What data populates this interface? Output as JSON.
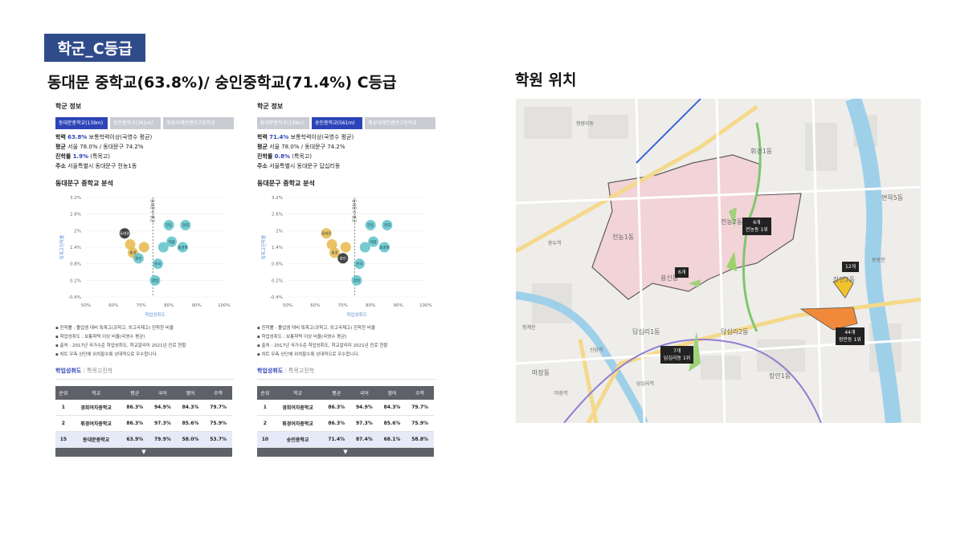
{
  "section_tag": "학군_C등급",
  "left_heading": "동대문 중학교(63.8%)/ 숭인중학교(71.4%) C등급",
  "right_heading": "학원 위치",
  "panels": [
    {
      "title": "학군 정보",
      "tabs": [
        "동대문중학교(139m)",
        "숭인중학교(361m)",
        "해성국제컨벤션고등학교"
      ],
      "active_tab": 0,
      "achievement_label": "학력",
      "achievement_value": "63.8%",
      "achievement_desc": "보통학력이상(국영수 평균)",
      "avg_label": "평균",
      "avg_value": "서울 78.0% / 동대문구 74.2%",
      "advance_label": "진학률",
      "advance_value": "1.9%",
      "advance_desc": "(특목고)",
      "addr_label": "주소",
      "addr_value": "서울특별시 동대문구 전농1동",
      "analysis_title": "동대문구 중학교 분석",
      "chart_data": {
        "type": "scatter",
        "xlabel": "학업성취도",
        "ylabel": "특목고진학률",
        "x_ticks": [
          "50%",
          "60%",
          "70%",
          "80%",
          "90%",
          "100%"
        ],
        "y_ticks": [
          "3.2%",
          "2.6%",
          "2%",
          "1.4%",
          "0.8%",
          "0.2%",
          "-0.4%"
        ],
        "xlim": [
          50,
          100
        ],
        "ylim": [
          -0.4,
          3.2
        ],
        "median_label": "동대문구 평균",
        "points": [
          {
            "label": "동대문",
            "x": 64,
            "y": 1.9,
            "color": "#222222"
          },
          {
            "label": "",
            "x": 66,
            "y": 1.5,
            "color": "#e8b84a"
          },
          {
            "label": "휘경",
            "x": 67,
            "y": 1.2,
            "color": "#e8b84a"
          },
          {
            "label": "",
            "x": 71,
            "y": 1.4,
            "color": "#e8b84a"
          },
          {
            "label": "숭인",
            "x": 69,
            "y": 1.0,
            "color": "#5cc2c9"
          },
          {
            "label": "전동",
            "x": 80,
            "y": 2.2,
            "color": "#5cc2c9"
          },
          {
            "label": "경희",
            "x": 86,
            "y": 2.2,
            "color": "#5cc2c9"
          },
          {
            "label": "대광",
            "x": 81,
            "y": 1.6,
            "color": "#5cc2c9"
          },
          {
            "label": "휘경여",
            "x": 85,
            "y": 1.4,
            "color": "#5cc2c9"
          },
          {
            "label": "",
            "x": 78,
            "y": 1.4,
            "color": "#5cc2c9"
          },
          {
            "label": "전곡",
            "x": 76,
            "y": 0.8,
            "color": "#5cc2c9"
          },
          {
            "label": "성일",
            "x": 75,
            "y": 0.2,
            "color": "#5cc2c9"
          }
        ]
      },
      "notes": [
        "▪ 진학률 : 졸업생 대비 특목고(과학고, 외고국제고) 진학한 비율",
        "▪ 학업성취도 : 보통학력 이상 비율(국영수 평균)",
        "▪ 출처 : 2017년 국가수준 학업성취도, 학교알리미 2021년 진로 현황",
        "▪ 차트 우측 상단에 위치할수록 상대적으로 우수합니다."
      ],
      "subtab_on": "학업성취도",
      "subtab_off": "특목고진학",
      "table_headers": [
        "순위",
        "학교",
        "평균",
        "국어",
        "영어",
        "수학"
      ],
      "table_rows": [
        [
          "1",
          "경희여자중학교",
          "86.3%",
          "94.9%",
          "84.3%",
          "79.7%"
        ],
        [
          "2",
          "휘경여자중학교",
          "86.3%",
          "97.3%",
          "85.6%",
          "75.9%"
        ],
        [
          "15",
          "동대문중학교",
          "63.9%",
          "79.9%",
          "58.0%",
          "53.7%"
        ]
      ],
      "more_glyph": "▼"
    },
    {
      "title": "학군 정보",
      "tabs": [
        "동대문중학교(139m)",
        "숭인중학교(561m)",
        "해성국제컨벤션고등학교"
      ],
      "active_tab": 1,
      "achievement_label": "학력",
      "achievement_value": "71.4%",
      "achievement_desc": "보통학력이상(국영수 평균)",
      "avg_label": "평균",
      "avg_value": "서울 78.0% / 동대문구 74.2%",
      "advance_label": "진학률",
      "advance_value": "0.8%",
      "advance_desc": "(특목고)",
      "addr_label": "주소",
      "addr_value": "서울특별시 동대문구 답십리동",
      "analysis_title": "동대문구 중학교 분석",
      "chart_data": {
        "type": "scatter",
        "xlabel": "학업성취도",
        "ylabel": "특목고진학률",
        "x_ticks": [
          "50%",
          "60%",
          "70%",
          "80%",
          "90%",
          "100%"
        ],
        "y_ticks": [
          "3.2%",
          "2.6%",
          "2%",
          "1.4%",
          "0.8%",
          "0.2%",
          "-0.4%"
        ],
        "xlim": [
          50,
          100
        ],
        "ylim": [
          -0.4,
          3.2
        ],
        "median_label": "동대문구 평균",
        "points": [
          {
            "label": "동대문",
            "x": 64,
            "y": 1.9,
            "color": "#e8b84a"
          },
          {
            "label": "",
            "x": 66,
            "y": 1.5,
            "color": "#e8b84a"
          },
          {
            "label": "휘경",
            "x": 67,
            "y": 1.2,
            "color": "#e8b84a"
          },
          {
            "label": "",
            "x": 71,
            "y": 1.4,
            "color": "#e8b84a"
          },
          {
            "label": "숭인",
            "x": 70,
            "y": 1.0,
            "color": "#222222"
          },
          {
            "label": "전동",
            "x": 80,
            "y": 2.2,
            "color": "#5cc2c9"
          },
          {
            "label": "경희",
            "x": 86,
            "y": 2.2,
            "color": "#5cc2c9"
          },
          {
            "label": "대광",
            "x": 81,
            "y": 1.6,
            "color": "#5cc2c9"
          },
          {
            "label": "휘경여",
            "x": 85,
            "y": 1.4,
            "color": "#5cc2c9"
          },
          {
            "label": "",
            "x": 78,
            "y": 1.4,
            "color": "#5cc2c9"
          },
          {
            "label": "전곡",
            "x": 76,
            "y": 0.8,
            "color": "#5cc2c9"
          },
          {
            "label": "성일",
            "x": 75,
            "y": 0.2,
            "color": "#5cc2c9"
          }
        ]
      },
      "notes": [
        "▪ 진학률 : 졸업생 대비 특목고(과학고, 외고국제고) 진학한 비율",
        "▪ 학업성취도 : 보통학력 이상 비율(국영수 평균)",
        "▪ 출처 : 2017년 국가수준 학업성취도, 학교알리미 2021년 진로 현황",
        "▪ 차트 우측 상단에 위치할수록 상대적으로 우수합니다."
      ],
      "subtab_on": "학업성취도",
      "subtab_off": "특목고진학",
      "table_headers": [
        "순위",
        "학교",
        "평균",
        "국어",
        "영어",
        "수학"
      ],
      "table_rows": [
        [
          "1",
          "경희여자중학교",
          "86.3%",
          "94.9%",
          "84.3%",
          "79.7%"
        ],
        [
          "2",
          "휘경여자중학교",
          "86.3%",
          "97.3%",
          "85.6%",
          "75.9%"
        ],
        [
          "10",
          "숭인중학교",
          "71.4%",
          "87.4%",
          "68.1%",
          "58.8%"
        ]
      ],
      "more_glyph": "▼"
    }
  ],
  "map": {
    "labels": [
      "청량리동",
      "전농1동",
      "전농2동",
      "휘경1동",
      "답십리1동",
      "답십리2동",
      "장안2동",
      "장안1동",
      "용신동",
      "신답역",
      "답십리역",
      "마장역",
      "마장동",
      "용두역",
      "면목5동",
      "청계천",
      "중랑천"
    ],
    "badges": [
      {
        "count": "6개",
        "sub": "전농동 1위"
      },
      {
        "count": "6개",
        "sub": ""
      },
      {
        "count": "12개",
        "sub": ""
      },
      {
        "count": "44개",
        "sub": "장안동 1위"
      },
      {
        "count": "7개",
        "sub": "답십리동 1위"
      }
    ]
  }
}
